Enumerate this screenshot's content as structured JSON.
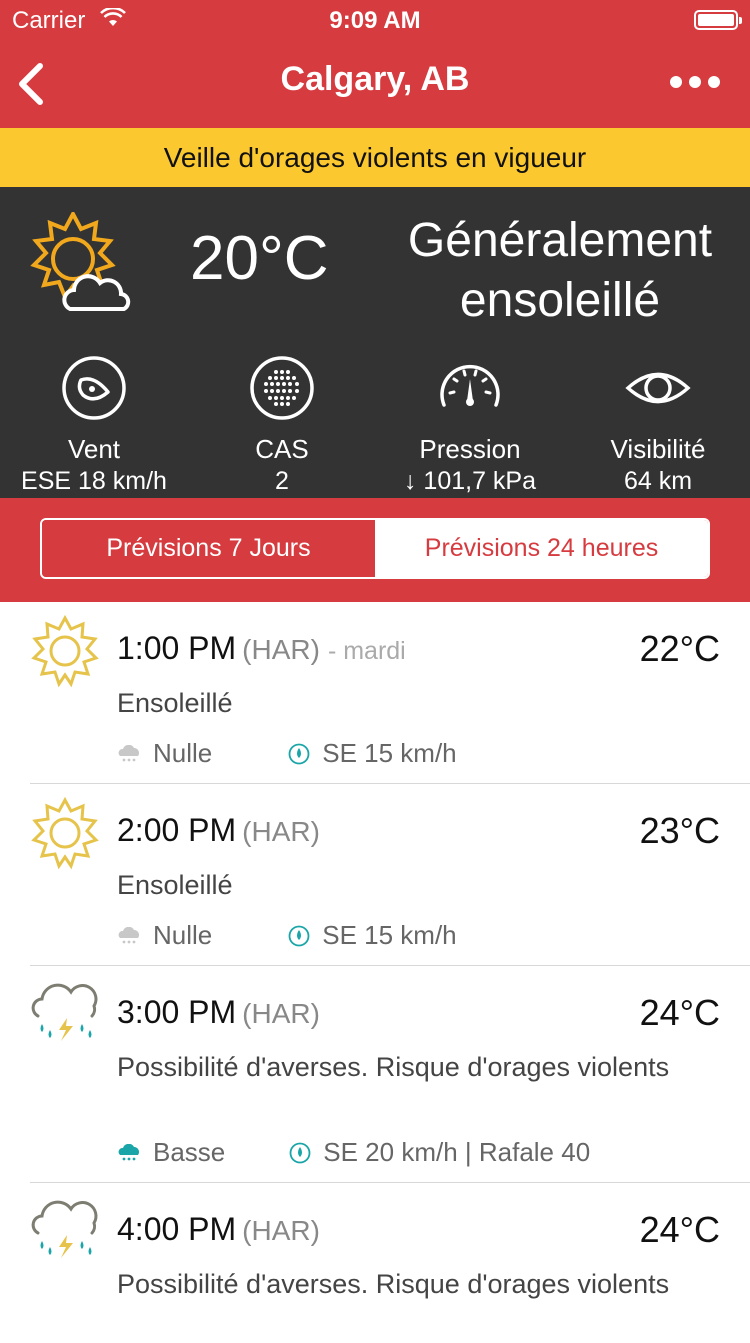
{
  "status_bar": {
    "carrier": "Carrier",
    "time": "9:09 AM"
  },
  "nav": {
    "title": "Calgary, AB"
  },
  "alert": {
    "text": "Veille d'orages violents en vigueur"
  },
  "current": {
    "temperature": "20°C",
    "condition": "Généralement ensoleillé",
    "icon": "sun-cloud-icon",
    "metrics": [
      {
        "icon": "wind-icon",
        "label": "Vent",
        "value": "ESE 18 km/h"
      },
      {
        "icon": "aqhi-icon",
        "label": "CAS",
        "value": "2"
      },
      {
        "icon": "pressure-gauge-icon",
        "label": "Pression",
        "value": "↓ 101,7 kPa"
      },
      {
        "icon": "eye-icon",
        "label": "Visibilité",
        "value": "64 km"
      }
    ]
  },
  "tabs": [
    {
      "label": "Prévisions 7 Jours",
      "active": true
    },
    {
      "label": "Prévisions 24 heures",
      "active": false
    }
  ],
  "forecast": [
    {
      "time": "1:00 PM",
      "zone": "(HAR)",
      "day": "- mardi",
      "temp": "22°C",
      "condition": "Ensoleillé",
      "precip": "Nulle",
      "wind": "SE 15 km/h",
      "icon": "sun-icon"
    },
    {
      "time": "2:00 PM",
      "zone": "(HAR)",
      "day": "",
      "temp": "23°C",
      "condition": "Ensoleillé",
      "precip": "Nulle",
      "wind": "SE 15 km/h",
      "icon": "sun-icon"
    },
    {
      "time": "3:00 PM",
      "zone": "(HAR)",
      "day": "",
      "temp": "24°C",
      "condition": "Possibilité d'averses. Risque d'orages violents",
      "precip": "Basse",
      "wind": "SE 20 km/h | Rafale 40",
      "icon": "thunderstorm-icon"
    },
    {
      "time": "4:00 PM",
      "zone": "(HAR)",
      "day": "",
      "temp": "24°C",
      "condition": "Possibilité d'averses. Risque d'orages violents",
      "precip": "",
      "wind": "",
      "icon": "thunderstorm-icon"
    }
  ],
  "colors": {
    "brand_red": "#d63b3f",
    "alert_yellow": "#fbc82f",
    "panel_dark": "#333333",
    "sun": "#f2a81d",
    "forecast_sun": "#e6c34a"
  }
}
